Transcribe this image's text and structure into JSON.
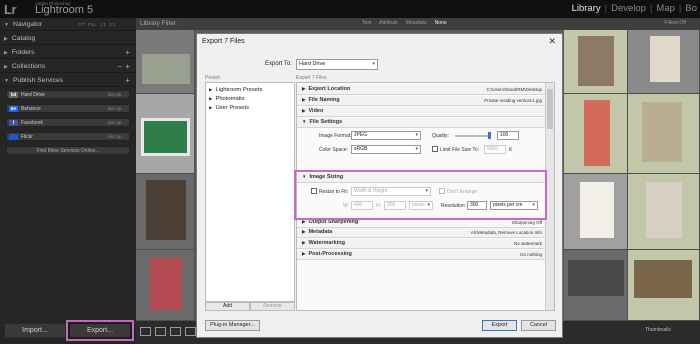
{
  "app": {
    "logo": "Lr",
    "brand_small": "Adobe Photoshop",
    "brand_name": "Lightroom 5",
    "modules": [
      "Library",
      "Develop",
      "Map",
      "Bo"
    ],
    "active_module": "Library"
  },
  "left_panel": {
    "navigator": {
      "label": "Navigator",
      "modes": [
        "FIT",
        "FILL",
        "1:1",
        "3:1"
      ]
    },
    "catalog": "Catalog",
    "folders": "Folders",
    "collections": "Collections",
    "publish_services": "Publish Services",
    "services": [
      {
        "icon": "hd",
        "name": "Hard Drive",
        "action": "Set Up..."
      },
      {
        "icon": "Be",
        "name": "Behance",
        "action": "Set Up..."
      },
      {
        "icon": "f",
        "name": "Facebook",
        "action": "Set Up..."
      },
      {
        "icon": "fl",
        "name": "Flickr",
        "action": "Set Up..."
      }
    ],
    "find_more": "Find More Services Online...",
    "import_label": "Import...",
    "export_label": "Export..."
  },
  "filter_bar": {
    "label": "Library Filter :",
    "options": [
      "Text",
      "Attribute",
      "Metadata",
      "None"
    ],
    "active": "None",
    "filters_off": "Filters Off"
  },
  "toolbar": {
    "thumbnails_label": "Thumbnails"
  },
  "dialog": {
    "title": "Export 7 Files",
    "export_to_label": "Export To:",
    "export_to_value": "Hard Drive",
    "preset_label": "Preset:",
    "export_files_label": "Export 7 Files",
    "presets": [
      "Lightroom Presets",
      "Photomatix",
      "User Presets"
    ],
    "add_label": "Add",
    "remove_label": "Remove",
    "sections": {
      "export_location": {
        "title": "Export Location",
        "summary": "C:\\Users\\SarahRM\\Desktop"
      },
      "file_naming": {
        "title": "File Naming",
        "summary": "Private residing vertical-1.jpg"
      },
      "video": {
        "title": "Video"
      },
      "file_settings": {
        "title": "File Settings"
      },
      "image_sizing": {
        "title": "Image Sizing"
      },
      "output_sharpening": {
        "title": "Output Sharpening",
        "summary": "Sharpening Off"
      },
      "metadata": {
        "title": "Metadata",
        "summary": "All Metadata, Remove Location Info"
      },
      "watermarking": {
        "title": "Watermarking",
        "summary": "No watermark"
      },
      "post_processing": {
        "title": "Post-Processing",
        "summary": "Do nothing"
      }
    },
    "file_settings": {
      "image_format_label": "Image Format:",
      "image_format": "JPEG",
      "quality_label": "Quality:",
      "quality": "100",
      "color_space_label": "Color Space:",
      "color_space": "sRGB",
      "limit_label": "Limit File Size To:",
      "limit_value": "5000",
      "limit_unit": "K"
    },
    "image_sizing": {
      "resize_label": "Resize to Fit:",
      "resize_mode": "Width & Height",
      "dont_enlarge": "Don't Enlarge",
      "w_label": "W:",
      "w_value": "400",
      "h_label": "H:",
      "h_value": "200",
      "units": "pixels",
      "resolution_label": "Resolution:",
      "resolution": "300",
      "resolution_unit": "pixels per cm"
    },
    "plugin_manager": "Plug-in Manager...",
    "export_button": "Export",
    "cancel_button": "Cancel"
  },
  "colors": {
    "highlight": "#c46ac2",
    "accent": "#3a74c9"
  }
}
